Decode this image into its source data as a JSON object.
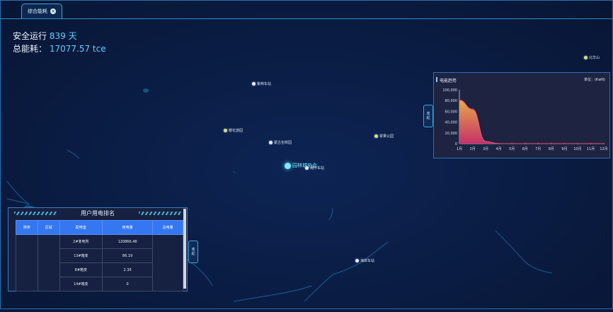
{
  "tabs": [
    {
      "label": "综合能耗",
      "close": "×"
    }
  ],
  "summary": {
    "safe_label": "安全运行",
    "safe_days": "839 天",
    "energy_label": "总能耗：",
    "energy_value": "17077.57 tce"
  },
  "map": {
    "center_label": "园林城协会",
    "pois": [
      {
        "label": "紫荆车站"
      },
      {
        "label": "北华山"
      },
      {
        "label": "樱花游园"
      },
      {
        "label": "蒙古包校园"
      },
      {
        "label": "翠果公园"
      },
      {
        "label": "潮汐车站"
      },
      {
        "label": "海岸车站"
      }
    ]
  },
  "trend_panel": {
    "title": "电能趋势",
    "unit": "单位：(KwN)",
    "collapse_label": [
      "收",
      "起"
    ],
    "chart_data": {
      "type": "area",
      "categories": [
        "1月",
        "2月",
        "3月",
        "4月",
        "5月",
        "6月",
        "7月",
        "8月",
        "9月",
        "10月",
        "11月",
        "12月"
      ],
      "series": [
        {
          "values": [
            81000,
            64000,
            4000,
            0,
            0,
            0,
            0,
            0,
            0,
            0,
            0,
            0
          ]
        }
      ],
      "y_ticks": [
        "100,000",
        "80,000",
        "60,000",
        "40,000",
        "20,000",
        "0"
      ],
      "ylim": [
        0,
        100000
      ],
      "colors": {
        "top": "#f0b04a",
        "bottom": "#d0306a"
      }
    }
  },
  "ranking_panel": {
    "title": "用户用电排名",
    "collapse_label": [
      "收",
      "起"
    ],
    "columns": [
      "排序",
      "区域",
      "配电室",
      "用电量",
      "总电量"
    ],
    "rows": [
      [
        "",
        "",
        "2#变电所",
        "120866.48",
        ""
      ],
      [
        "",
        "",
        "13#箱变",
        "86.19",
        ""
      ],
      [
        "",
        "",
        "8#箱变",
        "2.36",
        ""
      ],
      [
        "",
        "",
        "14#箱变",
        "0",
        ""
      ]
    ]
  }
}
